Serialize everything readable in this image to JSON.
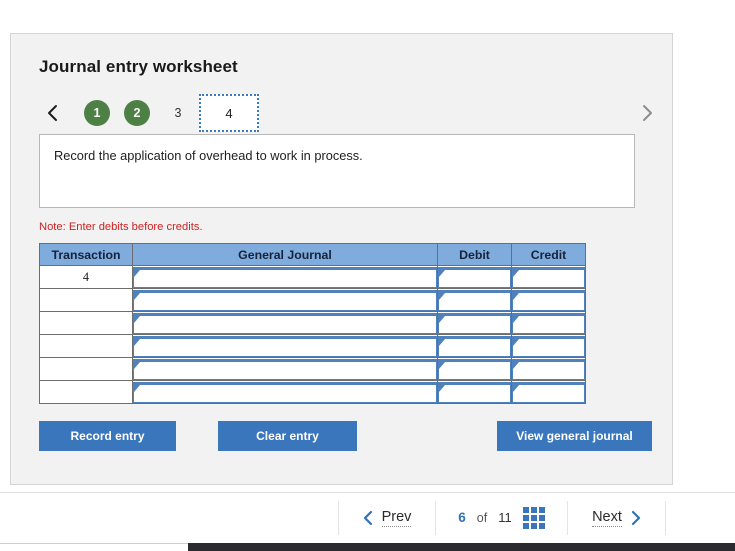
{
  "panel": {
    "title": "Journal entry worksheet",
    "stepper": {
      "prev_icon": "chevron-left-icon",
      "next_icon": "chevron-right-icon",
      "steps": [
        {
          "label": "1",
          "state": "complete"
        },
        {
          "label": "2",
          "state": "complete"
        },
        {
          "label": "3",
          "state": "pending"
        },
        {
          "label": "4",
          "state": "current"
        }
      ]
    },
    "instruction": "Record the application of overhead to work in process.",
    "note": "Note: Enter debits before credits.",
    "table": {
      "columns": [
        "Transaction",
        "General Journal",
        "Debit",
        "Credit"
      ],
      "rows": [
        {
          "transaction": "4",
          "general_journal": "",
          "debit": "",
          "credit": ""
        },
        {
          "transaction": "",
          "general_journal": "",
          "debit": "",
          "credit": ""
        },
        {
          "transaction": "",
          "general_journal": "",
          "debit": "",
          "credit": ""
        },
        {
          "transaction": "",
          "general_journal": "",
          "debit": "",
          "credit": ""
        },
        {
          "transaction": "",
          "general_journal": "",
          "debit": "",
          "credit": ""
        },
        {
          "transaction": "",
          "general_journal": "",
          "debit": "",
          "credit": ""
        }
      ]
    },
    "buttons": {
      "record": "Record entry",
      "clear": "Clear entry",
      "view": "View general journal"
    }
  },
  "pagination": {
    "prev_label": "Prev",
    "next_label": "Next",
    "current_page": "6",
    "of_label": "of",
    "total_pages": "11",
    "grid_icon": "grid-view-icon",
    "prev_icon": "chevron-left-icon",
    "next_icon": "chevron-right-icon"
  },
  "colors": {
    "panel_background": "#f2f2f2",
    "button_blue": "#3a76bb",
    "table_header_blue": "#7fabdd",
    "input_border_blue": "#4f81bd",
    "step_complete_green": "#4c8044",
    "note_red": "#cc2222",
    "link_blue": "#2f72b8"
  }
}
